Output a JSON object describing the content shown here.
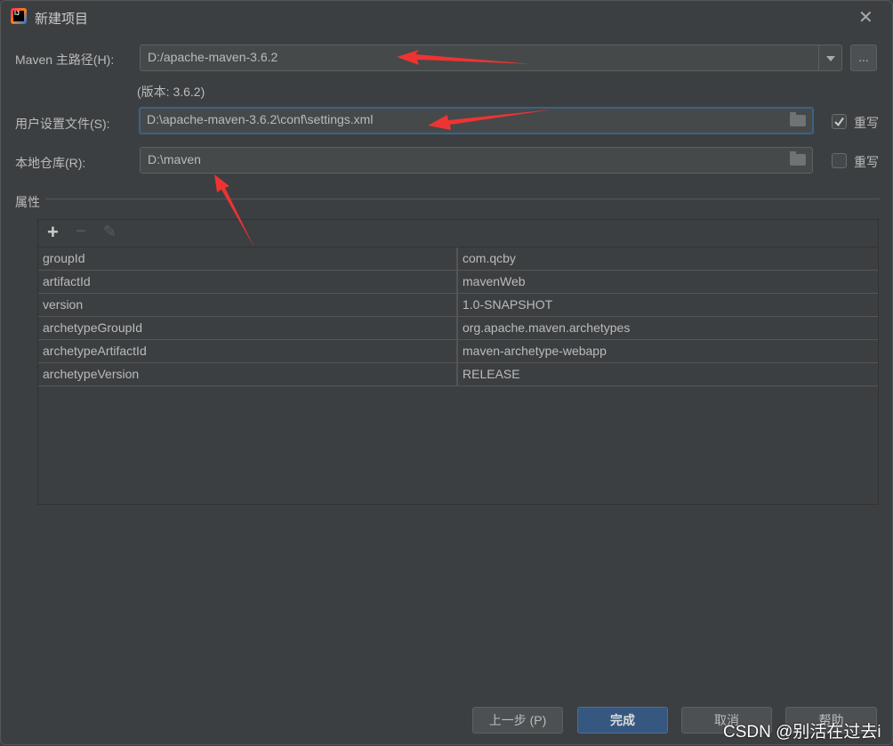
{
  "window": {
    "title": "新建项目",
    "close": "✕"
  },
  "maven_home": {
    "label": "Maven 主路径(H):",
    "value": "D:/apache-maven-3.6.2",
    "browse": "...",
    "version": "(版本: 3.6.2)"
  },
  "settings_file": {
    "label": "用户设置文件(S):",
    "value": "D:\\apache-maven-3.6.2\\conf\\settings.xml",
    "override_label": "重写",
    "override_checked": true
  },
  "local_repo": {
    "label": "本地仓库(R):",
    "value": "D:\\maven",
    "override_label": "重写",
    "override_checked": false
  },
  "properties": {
    "title": "属性",
    "toolbar": {
      "add": "+",
      "remove": "−",
      "edit": "✎"
    },
    "rows": [
      {
        "key": "groupId",
        "value": "com.qcby"
      },
      {
        "key": "artifactId",
        "value": "mavenWeb"
      },
      {
        "key": "version",
        "value": "1.0-SNAPSHOT"
      },
      {
        "key": "archetypeGroupId",
        "value": "org.apache.maven.archetypes"
      },
      {
        "key": "archetypeArtifactId",
        "value": "maven-archetype-webapp"
      },
      {
        "key": "archetypeVersion",
        "value": "RELEASE"
      }
    ]
  },
  "buttons": {
    "prev": "上一步 (P)",
    "finish": "完成",
    "cancel": "取消",
    "help": "帮助"
  },
  "watermark": "CSDN @别活在过去i",
  "colors": {
    "accent": "#365880",
    "annotation": "#ee3333"
  }
}
